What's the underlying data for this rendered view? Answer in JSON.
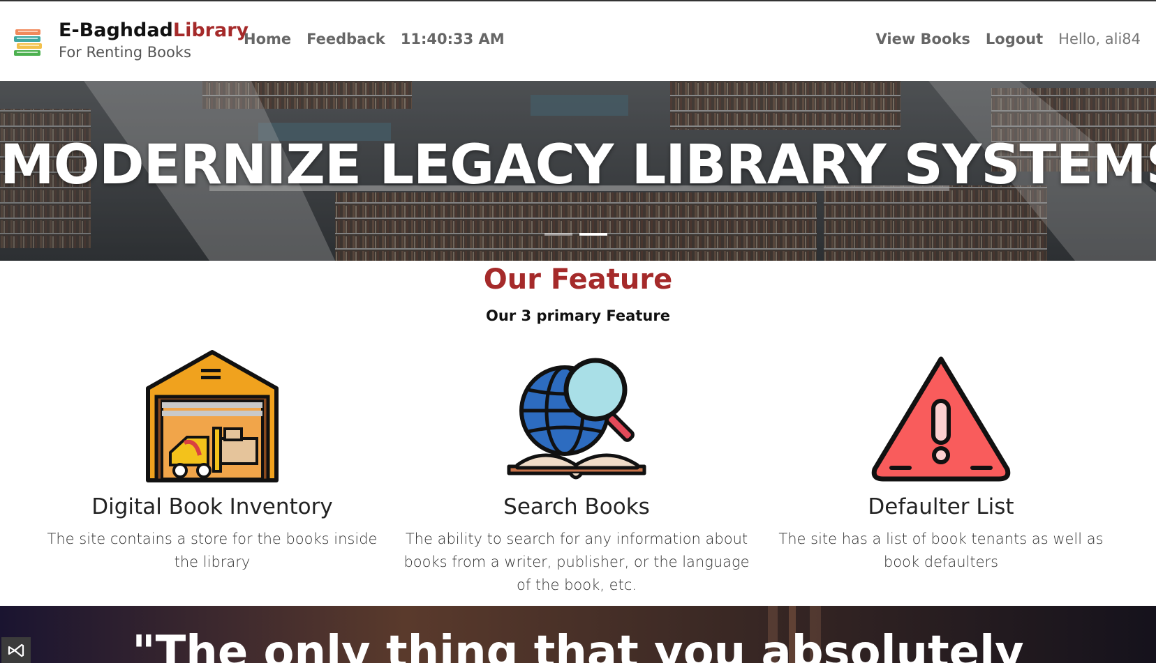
{
  "navbar": {
    "brand_name": "E-Baghdad",
    "brand_name_accent": "Library",
    "brand_tagline": "For Renting Books",
    "home_label": "Home",
    "feedback_label": "Feedback",
    "clock": "11:40:33 AM",
    "view_books_label": "View Books",
    "logout_label": "Logout",
    "greeting": "Hello, ali84"
  },
  "hero": {
    "title": "MODERNIZE LEGACY LIBRARY SYSTEMS",
    "prev_glyph": "‹",
    "slides": 2,
    "active_slide": 2
  },
  "features": {
    "title": "Our Feature",
    "subtitle": "Our 3 primary Feature",
    "items": [
      {
        "icon": "warehouse-icon",
        "title": "Digital Book Inventory",
        "description": "The site contains a store for the books inside the library"
      },
      {
        "icon": "globe-search-book-icon",
        "title": "Search Books",
        "description": "The ability to search for any information about books from a writer, publisher, or the language of the book, etc."
      },
      {
        "icon": "warning-triangle-icon",
        "title": "Defaulter List",
        "description": "The site has a list of book tenants as well as book defaulters"
      }
    ]
  },
  "quote": {
    "text": "\"The only thing that you absolutely"
  },
  "colors": {
    "accent": "#a52a2a",
    "nav_text": "#666666"
  }
}
